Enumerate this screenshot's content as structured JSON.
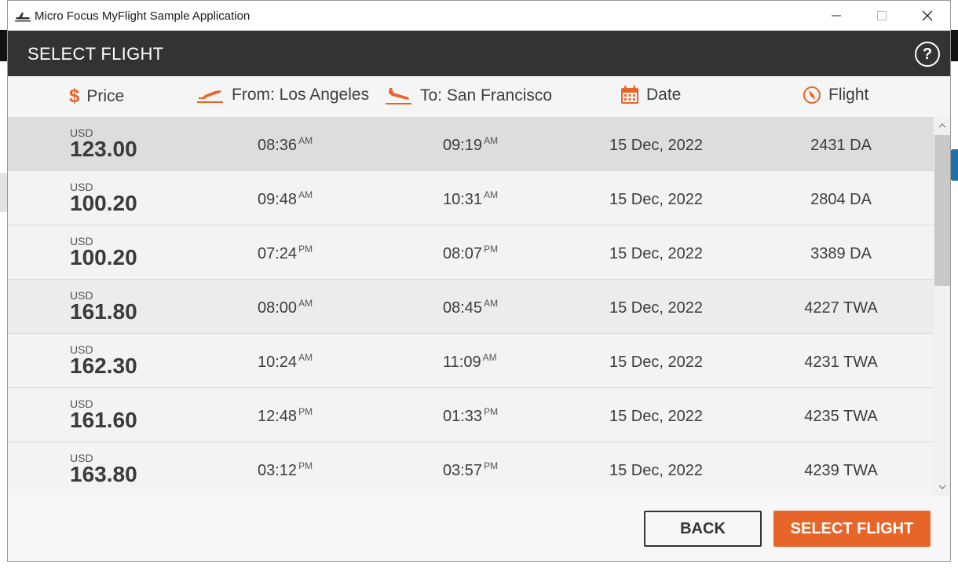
{
  "window": {
    "title": "Micro Focus MyFlight Sample Application"
  },
  "header": {
    "title": "SELECT FLIGHT",
    "help_label": "?"
  },
  "columns": {
    "price": "Price",
    "price_icon": "$",
    "from": "From: Los Angeles",
    "to": "To: San Francisco",
    "date": "Date",
    "flight": "Flight"
  },
  "colors": {
    "accent": "#e8652a",
    "header_bg": "#333333",
    "selected_row": "#dddddd"
  },
  "flights": [
    {
      "currency": "USD",
      "price": "123.00",
      "dep_time": "08:36",
      "dep_ampm": "AM",
      "arr_time": "09:19",
      "arr_ampm": "AM",
      "date": "15 Dec, 2022",
      "flight": "2431 DA"
    },
    {
      "currency": "USD",
      "price": "100.20",
      "dep_time": "09:48",
      "dep_ampm": "AM",
      "arr_time": "10:31",
      "arr_ampm": "AM",
      "date": "15 Dec, 2022",
      "flight": "2804 DA"
    },
    {
      "currency": "USD",
      "price": "100.20",
      "dep_time": "07:24",
      "dep_ampm": "PM",
      "arr_time": "08:07",
      "arr_ampm": "PM",
      "date": "15 Dec, 2022",
      "flight": "3389 DA"
    },
    {
      "currency": "USD",
      "price": "161.80",
      "dep_time": "08:00",
      "dep_ampm": "AM",
      "arr_time": "08:45",
      "arr_ampm": "AM",
      "date": "15 Dec, 2022",
      "flight": "4227 TWA"
    },
    {
      "currency": "USD",
      "price": "162.30",
      "dep_time": "10:24",
      "dep_ampm": "AM",
      "arr_time": "11:09",
      "arr_ampm": "AM",
      "date": "15 Dec, 2022",
      "flight": "4231 TWA"
    },
    {
      "currency": "USD",
      "price": "161.60",
      "dep_time": "12:48",
      "dep_ampm": "PM",
      "arr_time": "01:33",
      "arr_ampm": "PM",
      "date": "15 Dec, 2022",
      "flight": "4235 TWA"
    },
    {
      "currency": "USD",
      "price": "163.80",
      "dep_time": "03:12",
      "dep_ampm": "PM",
      "arr_time": "03:57",
      "arr_ampm": "PM",
      "date": "15 Dec, 2022",
      "flight": "4239 TWA"
    }
  ],
  "buttons": {
    "back": "BACK",
    "select": "SELECT FLIGHT"
  }
}
